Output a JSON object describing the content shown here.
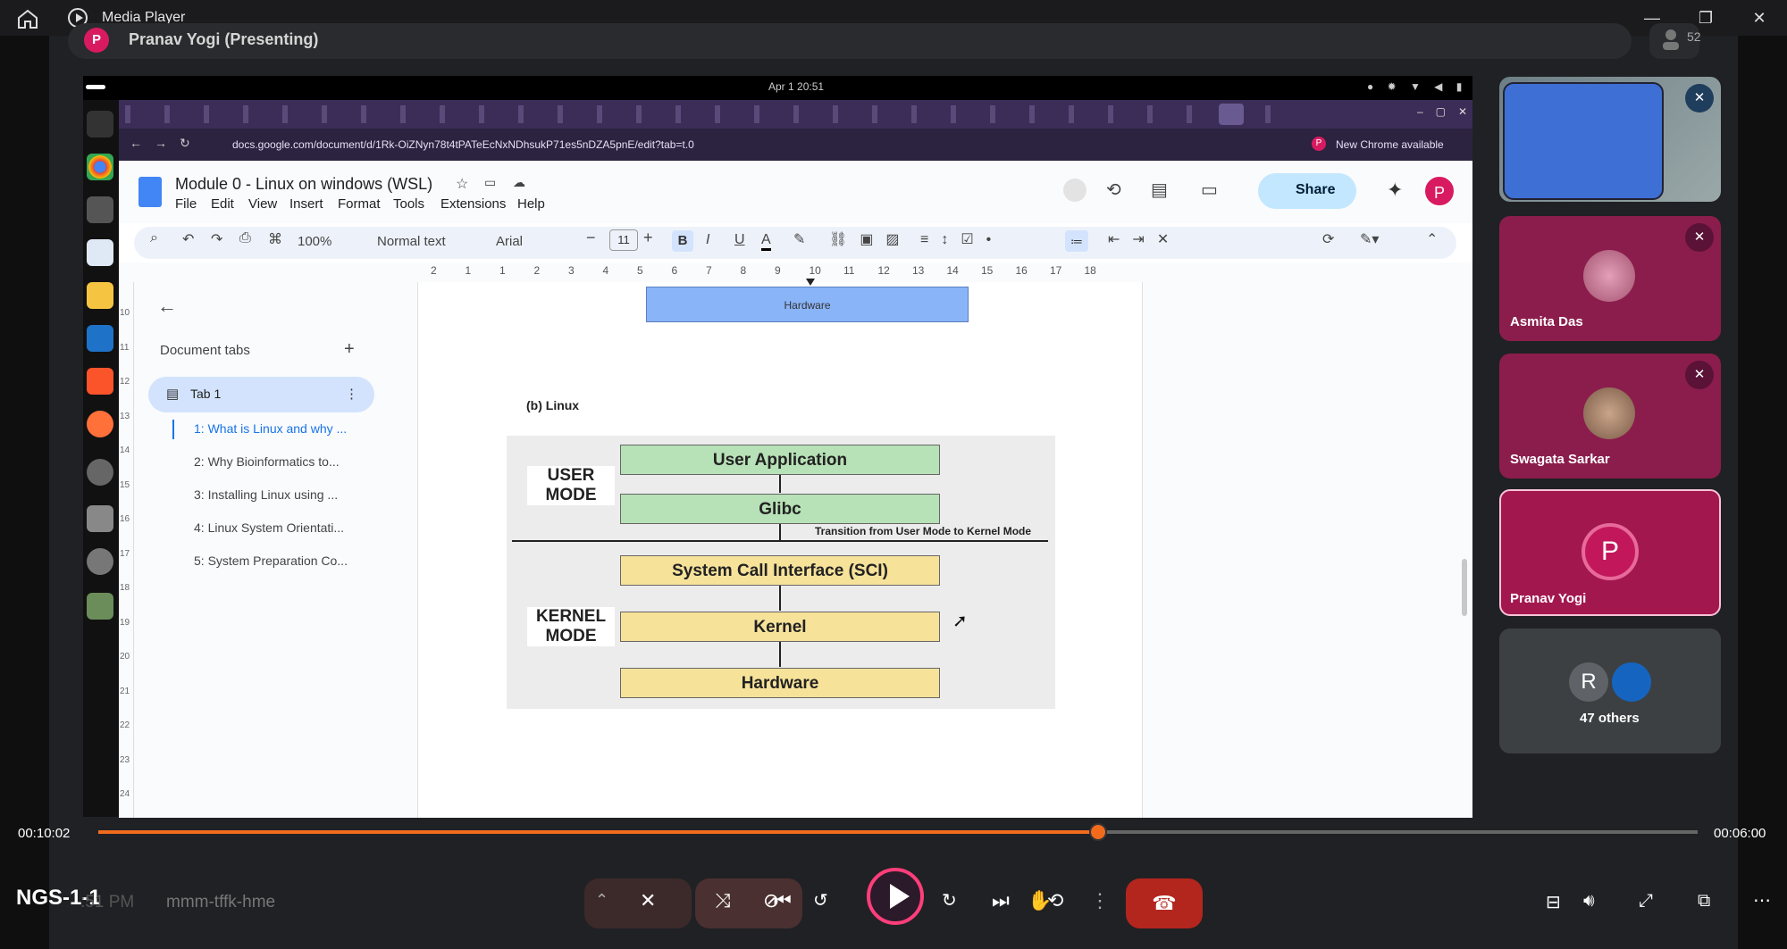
{
  "media_player": {
    "title": "Media Player",
    "minimize": "—",
    "restore": "❐",
    "close": "✕"
  },
  "meet": {
    "presenter_initial": "P",
    "presenter_label": "Pranav Yogi (Presenting)",
    "participant_count": "52",
    "meeting_name": "NGS-1-1",
    "meeting_time": ":51 PM",
    "meeting_code": "mmm-tffk-hme"
  },
  "os_topbar": {
    "datetime": "Apr 1  20:51"
  },
  "browser": {
    "url": "docs.google.com/document/d/1Rk-OiZNyn78t4tPATeEcNxNDhsukP71es5nDZA5pnE/edit?tab=t.0",
    "new_chrome": "New Chrome available",
    "profile_initial": "P"
  },
  "docs": {
    "title": "Module 0 - Linux on windows (WSL)",
    "menu": [
      "File",
      "Edit",
      "View",
      "Insert",
      "Format",
      "Tools",
      "Extensions",
      "Help"
    ],
    "share": "Share",
    "zoom": "100%",
    "style": "Normal text",
    "font": "Arial",
    "font_size": "11",
    "ruler": [
      "2",
      "1",
      "1",
      "2",
      "3",
      "4",
      "5",
      "6",
      "7",
      "8",
      "9",
      "10",
      "11",
      "12",
      "13",
      "14",
      "15",
      "16",
      "17",
      "18"
    ],
    "left_ruler": [
      "10",
      "11",
      "12",
      "13",
      "14",
      "15",
      "16",
      "17",
      "18",
      "19",
      "20",
      "21",
      "22",
      "23",
      "24"
    ],
    "panel": {
      "header": "Document tabs",
      "tab1": "Tab 1",
      "outline": [
        "1: What is Linux and why ...",
        "2: Why Bioinformatics to...",
        "3: Installing Linux using ...",
        "4: Linux System Orientati...",
        "5: System Preparation Co..."
      ]
    },
    "diagram": {
      "hardware_top": "Hardware",
      "caption": "(b) Linux",
      "user_mode": "USER MODE",
      "kernel_mode": "KERNEL MODE",
      "user_application": "User Application",
      "glibc": "Glibc",
      "transition": "Transition from User Mode to Kernel Mode",
      "sci": "System Call Interface (SCI)",
      "kernel": "Kernel",
      "hardware": "Hardware"
    }
  },
  "participants": [
    {
      "name": ""
    },
    {
      "name": "Asmita Das"
    },
    {
      "name": "Swagata Sarkar"
    },
    {
      "name": "Pranav Yogi",
      "initial": "P"
    },
    {
      "name": "47 others",
      "initial": "R"
    }
  ],
  "player": {
    "elapsed": "00:10:02",
    "remaining": "00:06:00",
    "progress": 0.625
  },
  "colors": {
    "accent": "#f26b1d",
    "share_bg": "#c2e7ff",
    "tile_pink": "#a3174f"
  }
}
